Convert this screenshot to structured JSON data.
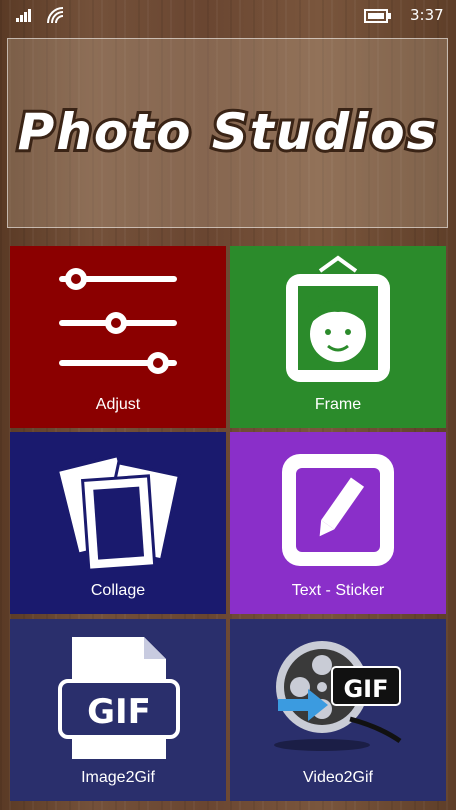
{
  "status_bar": {
    "time": "3:37"
  },
  "banner": {
    "title": "Photo Studios"
  },
  "tiles": [
    {
      "label": "Adjust",
      "color": "#8b0000",
      "icon": "sliders-icon"
    },
    {
      "label": "Frame",
      "color": "#2b8b2b",
      "icon": "portrait-frame-icon"
    },
    {
      "label": "Collage",
      "color": "#1a1a6e",
      "icon": "collage-photos-icon"
    },
    {
      "label": "Text - Sticker",
      "color": "#8a2fc9",
      "icon": "pencil-frame-icon"
    },
    {
      "label": "Image2Gif",
      "color": "#2a2f6c",
      "icon": "gif-document-icon"
    },
    {
      "label": "Video2Gif",
      "color": "#2a2f6c",
      "icon": "film-reel-gif-icon"
    }
  ]
}
